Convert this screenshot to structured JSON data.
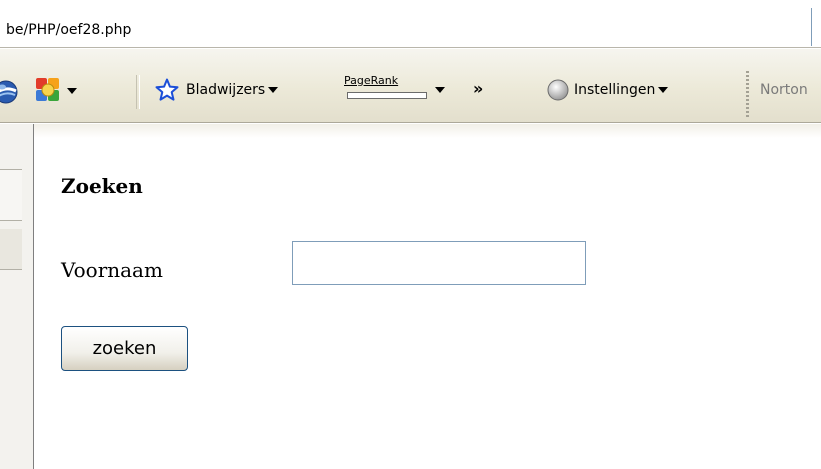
{
  "address_bar": {
    "url": "be/PHP/oef28.php"
  },
  "toolbar": {
    "icons": [
      "globe-icon",
      "addon-icon",
      "star-icon",
      "chevron-icon",
      "settings-icon"
    ],
    "bookmarks_label": "Bladwijzers",
    "pagerank_label": "PageRank",
    "pagerank_level": 0.0,
    "more_label": "»",
    "settings_label": "Instellingen",
    "norton_label": "Norton"
  },
  "page": {
    "heading": "Zoeken",
    "field_label": "Voornaam",
    "field_value": "",
    "submit_label": "zoeken"
  },
  "colors": {
    "toolbar_bg": "#ece9d8",
    "input_border": "#7f9db9",
    "button_border": "#1c5180"
  }
}
